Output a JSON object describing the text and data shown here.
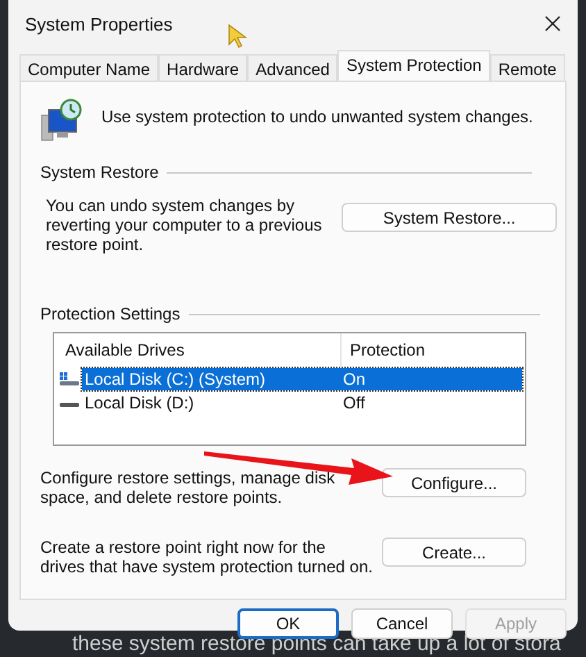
{
  "window": {
    "title": "System Properties"
  },
  "tabs": [
    {
      "label": "Computer Name",
      "selected": false
    },
    {
      "label": "Hardware",
      "selected": false
    },
    {
      "label": "Advanced",
      "selected": false
    },
    {
      "label": "System Protection",
      "selected": true
    },
    {
      "label": "Remote",
      "selected": false
    }
  ],
  "intro": "Use system protection to undo unwanted system changes.",
  "system_restore": {
    "heading": "System Restore",
    "description": "You can undo system changes by reverting your computer to a previous restore point.",
    "button": "System Restore..."
  },
  "protection_settings": {
    "heading": "Protection Settings",
    "columns": [
      "Available Drives",
      "Protection"
    ],
    "drives": [
      {
        "name": "Local Disk (C:) (System)",
        "protection": "On",
        "selected": true,
        "kind": "system"
      },
      {
        "name": "Local Disk (D:)",
        "protection": "Off",
        "selected": false,
        "kind": "disk"
      }
    ]
  },
  "configure": {
    "description": "Configure restore settings, manage disk space, and delete restore points.",
    "button": "Configure..."
  },
  "create": {
    "description": "Create a restore point right now for the drives that have system protection turned on.",
    "button": "Create..."
  },
  "buttons": [
    {
      "label": "OK",
      "kind": "default",
      "disabled": false
    },
    {
      "label": "Cancel",
      "kind": "normal",
      "disabled": false
    },
    {
      "label": "Apply",
      "kind": "normal",
      "disabled": true
    }
  ],
  "background_text": "these system restore points can take up a lot of stora"
}
